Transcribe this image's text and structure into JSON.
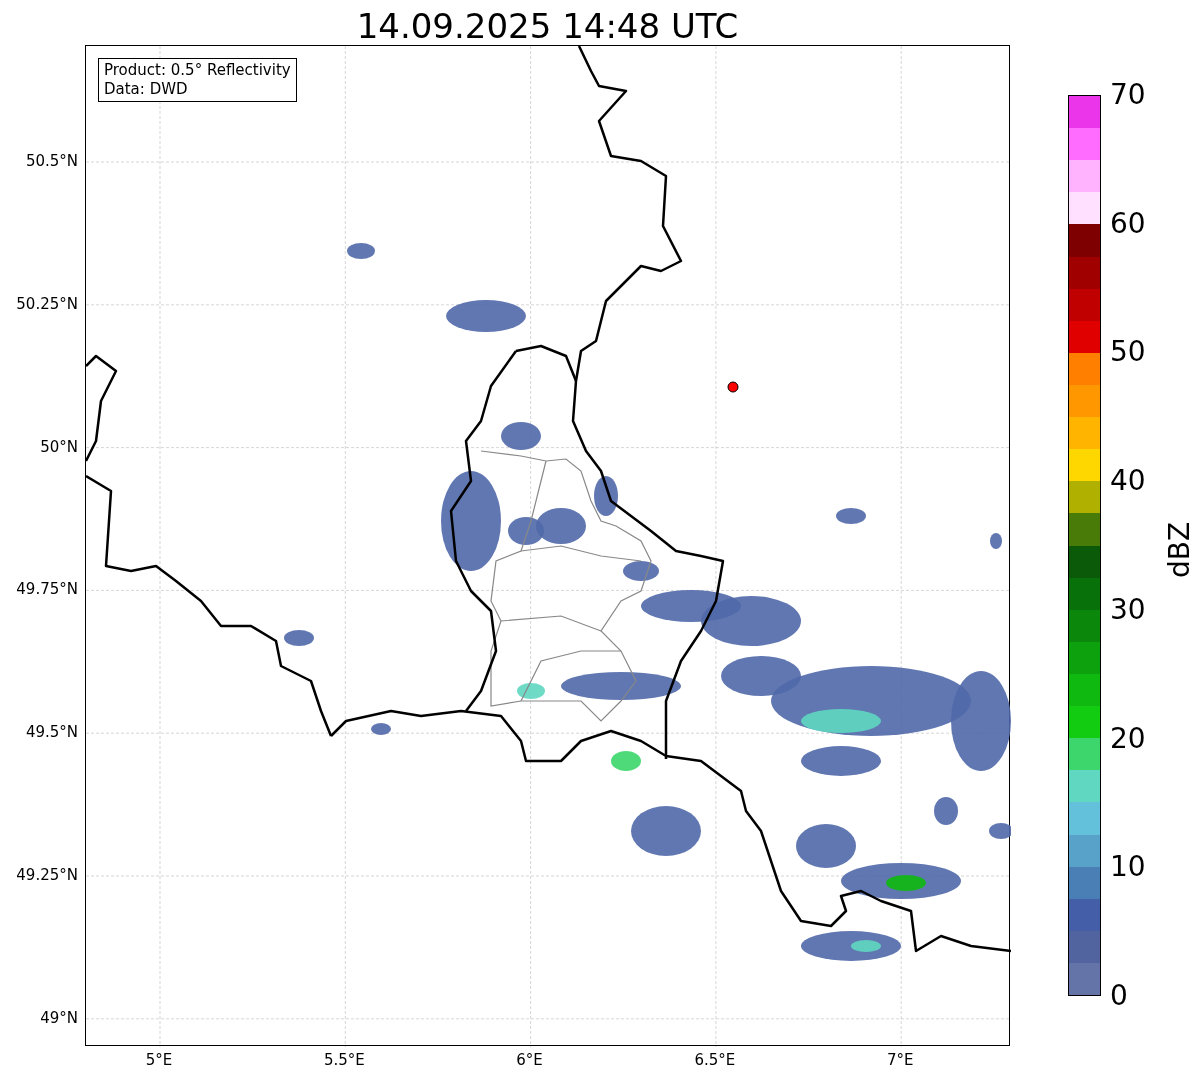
{
  "title": "14.09.2025 14:48 UTC",
  "legend": {
    "lines": [
      "Product: 0.5° Reflectivity",
      "Data: DWD"
    ]
  },
  "map": {
    "lat_labels": [
      "50.5°N",
      "50.25°N",
      "50°N",
      "49.75°N",
      "49.5°N",
      "49.25°N",
      "49°N"
    ],
    "lon_labels": [
      "5°E",
      "5.5°E",
      "6°E",
      "6.5°E",
      "7°E"
    ]
  },
  "colorbar": {
    "label": "dBZ",
    "ticks": [
      "70",
      "60",
      "50",
      "40",
      "30",
      "20",
      "10",
      "0"
    ],
    "segments": [
      {
        "color": "#eb35eb"
      },
      {
        "color": "#ff6cff"
      },
      {
        "color": "#ffb3ff"
      },
      {
        "color": "#ffe0ff"
      },
      {
        "color": "#7f0000"
      },
      {
        "color": "#a00000"
      },
      {
        "color": "#c00000"
      },
      {
        "color": "#e00000"
      },
      {
        "color": "#ff7f00"
      },
      {
        "color": "#ff9800"
      },
      {
        "color": "#ffb400"
      },
      {
        "color": "#ffd700"
      },
      {
        "color": "#b0b000"
      },
      {
        "color": "#487b08"
      },
      {
        "color": "#0a5a0a"
      },
      {
        "color": "#097109"
      },
      {
        "color": "#0b870b"
      },
      {
        "color": "#0ea10e"
      },
      {
        "color": "#10b910"
      },
      {
        "color": "#12cc12"
      },
      {
        "color": "#3cd66c"
      },
      {
        "color": "#5fd7c1"
      },
      {
        "color": "#64c1dc"
      },
      {
        "color": "#58a1c8"
      },
      {
        "color": "#4a7fb5"
      },
      {
        "color": "#445fa8"
      },
      {
        "color": "#5264a0"
      },
      {
        "color": "#6473a8"
      }
    ]
  }
}
